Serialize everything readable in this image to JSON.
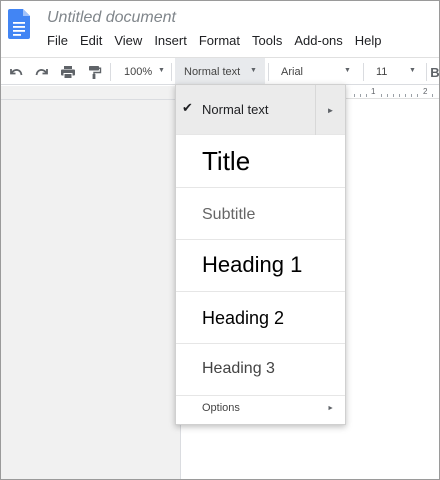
{
  "document": {
    "title": "Untitled document"
  },
  "menu": {
    "items": [
      "File",
      "Edit",
      "View",
      "Insert",
      "Format",
      "Tools",
      "Add-ons",
      "Help"
    ]
  },
  "toolbar": {
    "icons": [
      "undo-icon",
      "redo-icon",
      "print-icon",
      "paint-format-icon"
    ],
    "zoom": "100%",
    "style": "Normal text",
    "font": "Arial",
    "font_size": "11"
  },
  "ruler": {
    "labels": [
      "1",
      "2"
    ]
  },
  "style_menu": {
    "selected": "Normal text",
    "items": [
      {
        "label": "Normal text",
        "checked": true
      },
      {
        "label": "Title"
      },
      {
        "label": "Subtitle"
      },
      {
        "label": "Heading 1"
      },
      {
        "label": "Heading 2"
      },
      {
        "label": "Heading 3"
      }
    ],
    "options_label": "Options"
  },
  "colors": {
    "brand": "#4285f4",
    "menu_highlight": "#ebebeb",
    "canvas": "#f1f1f1"
  }
}
